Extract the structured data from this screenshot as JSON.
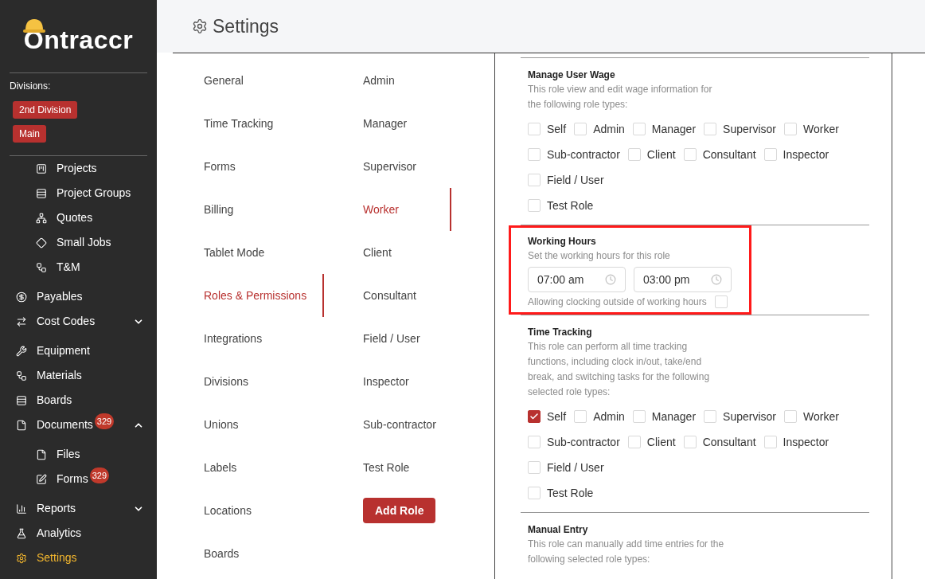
{
  "logo": {
    "text": "Ontraccr"
  },
  "sidebar": {
    "divisions_label": "Divisions:",
    "divisions": [
      "2nd Division",
      "Main"
    ],
    "continued_children": [
      {
        "label": "Projects",
        "selected": false
      },
      {
        "label": "Project Groups",
        "selected": false
      },
      {
        "label": "Quotes",
        "selected": false
      },
      {
        "label": "Small Jobs",
        "selected": false
      },
      {
        "label": "T&M",
        "selected": false
      }
    ],
    "items": [
      {
        "label": "Payables",
        "selected": false
      },
      {
        "label": "Cost Codes",
        "selected": false,
        "expanded": false
      },
      {
        "label": "Equipment",
        "selected": false
      },
      {
        "label": "Materials",
        "selected": false
      },
      {
        "label": "Boards",
        "selected": false
      },
      {
        "label": "Documents",
        "selected": false,
        "badge": "329",
        "expanded": true,
        "children": [
          {
            "label": "Files",
            "selected": false
          },
          {
            "label": "Forms",
            "selected": false,
            "badge": "329"
          }
        ]
      },
      {
        "label": "Reports",
        "selected": false,
        "expanded": false
      },
      {
        "label": "Analytics",
        "selected": false
      },
      {
        "label": "Settings",
        "selected": true
      }
    ]
  },
  "header": {
    "title": "Settings"
  },
  "settings_nav": [
    {
      "label": "General",
      "selected": false
    },
    {
      "label": "Time Tracking",
      "selected": false
    },
    {
      "label": "Forms",
      "selected": false
    },
    {
      "label": "Billing",
      "selected": false
    },
    {
      "label": "Tablet Mode",
      "selected": false
    },
    {
      "label": "Roles & Permissions",
      "selected": true
    },
    {
      "label": "Integrations",
      "selected": false
    },
    {
      "label": "Divisions",
      "selected": false
    },
    {
      "label": "Unions",
      "selected": false
    },
    {
      "label": "Labels",
      "selected": false
    },
    {
      "label": "Locations",
      "selected": false
    },
    {
      "label": "Boards",
      "selected": false
    }
  ],
  "roles": [
    {
      "label": "Admin",
      "selected": false
    },
    {
      "label": "Manager",
      "selected": false
    },
    {
      "label": "Supervisor",
      "selected": false
    },
    {
      "label": "Worker",
      "selected": true
    },
    {
      "label": "Client",
      "selected": false
    },
    {
      "label": "Consultant",
      "selected": false
    },
    {
      "label": "Field / User",
      "selected": false
    },
    {
      "label": "Inspector",
      "selected": false
    },
    {
      "label": "Sub-contractor",
      "selected": false
    },
    {
      "label": "Test Role",
      "selected": false
    }
  ],
  "add_role_button": "Add Role",
  "sections": [
    {
      "kind": "roles",
      "title": "Manage User Wage",
      "description": [
        "This role view and edit wage information for",
        "the following role types:"
      ],
      "highlighted": false,
      "option_rows": [
        [
          {
            "label": "Self",
            "checked": false
          },
          {
            "label": "Admin",
            "checked": false
          },
          {
            "label": "Manager",
            "checked": false
          },
          {
            "label": "Supervisor",
            "checked": false
          },
          {
            "label": "Worker",
            "checked": false
          }
        ],
        [
          {
            "label": "Sub-contractor",
            "checked": false
          },
          {
            "label": "Client",
            "checked": false
          },
          {
            "label": "Consultant",
            "checked": false
          },
          {
            "label": "Inspector",
            "checked": false
          }
        ],
        [
          {
            "label": "Field / User",
            "checked": false
          }
        ],
        [
          {
            "label": "Test Role",
            "checked": false
          }
        ]
      ]
    },
    {
      "kind": "hours",
      "title": "Working Hours",
      "description": [
        "Set the working hours for this role"
      ],
      "highlighted": true,
      "start": "07:00 am",
      "end": "03:00 pm",
      "allow_label": "Allowing clocking outside of working hours",
      "allow_checked": false
    },
    {
      "kind": "roles",
      "title": "Time Tracking",
      "description": [
        "This role can perform all time tracking",
        "functions, including clock in/out, take/end",
        "break, and switching tasks for the following",
        "selected role types:"
      ],
      "highlighted": false,
      "option_rows": [
        [
          {
            "label": "Self",
            "checked": true
          },
          {
            "label": "Admin",
            "checked": false
          },
          {
            "label": "Manager",
            "checked": false
          },
          {
            "label": "Supervisor",
            "checked": false
          },
          {
            "label": "Worker",
            "checked": false
          }
        ],
        [
          {
            "label": "Sub-contractor",
            "checked": false
          },
          {
            "label": "Client",
            "checked": false
          },
          {
            "label": "Consultant",
            "checked": false
          },
          {
            "label": "Inspector",
            "checked": false
          }
        ],
        [
          {
            "label": "Field / User",
            "checked": false
          }
        ],
        [
          {
            "label": "Test Role",
            "checked": false
          }
        ]
      ]
    },
    {
      "kind": "roles",
      "title": "Manual Entry",
      "description": [
        "This role can manually add time entries for the",
        "following selected role types:"
      ],
      "highlighted": false
    }
  ]
}
